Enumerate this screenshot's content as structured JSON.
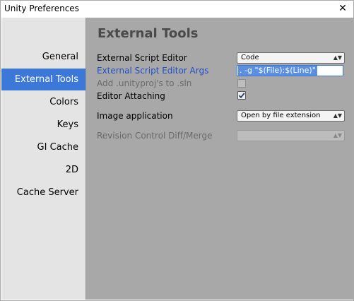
{
  "window": {
    "title": "Unity Preferences",
    "close_glyph": "✕"
  },
  "sidebar": {
    "items": [
      {
        "label": "General",
        "active": false
      },
      {
        "label": "External Tools",
        "active": true
      },
      {
        "label": "Colors",
        "active": false
      },
      {
        "label": "Keys",
        "active": false
      },
      {
        "label": "GI Cache",
        "active": false
      },
      {
        "label": "2D",
        "active": false
      },
      {
        "label": "Cache Server",
        "active": false
      }
    ]
  },
  "main": {
    "title": "External Tools",
    "script_editor": {
      "label": "External Script Editor",
      "value": "Code"
    },
    "script_editor_args": {
      "label": "External Script Editor Args",
      "value": ". -g \"$(File):$(Line)\""
    },
    "add_unityproj": {
      "label": "Add .unityproj's to .sln",
      "checked": false,
      "enabled": false
    },
    "editor_attaching": {
      "label": "Editor Attaching",
      "checked": true
    },
    "image_application": {
      "label": "Image application",
      "value": "Open by file extension"
    },
    "revision_control": {
      "label": "Revision Control Diff/Merge",
      "value": "",
      "enabled": false
    }
  },
  "icons": {
    "dropdown_arrow": "updown-arrows-icon",
    "checkmark": "checkmark-icon",
    "close": "close-icon"
  },
  "colors": {
    "selection_accent": "#3c78d8",
    "panel_bg": "#a8a8a8",
    "sidebar_bg": "#e4e4e4"
  }
}
